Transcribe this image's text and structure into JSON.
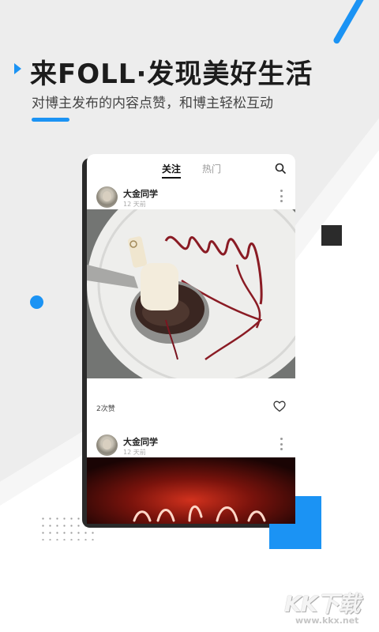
{
  "promo": {
    "headline": "来FOLL·发现美好生活",
    "subline": "对博主发布的内容点赞，和博主轻松互动"
  },
  "colors": {
    "accent": "#1b93f4",
    "dark": "#2b2b2b",
    "background_gray": "#ededed"
  },
  "feed": {
    "tabs": [
      {
        "label": "关注",
        "active": true
      },
      {
        "label": "热门",
        "active": false
      }
    ],
    "search_icon": "search-icon",
    "posts": [
      {
        "author": "大金同学",
        "time": "12 天前",
        "likes": "2次赞",
        "image": "dessert-plate-photo"
      },
      {
        "author": "大金同学",
        "time": "12 天前",
        "image": "red-neon-sign-photo"
      }
    ]
  },
  "watermark": {
    "title": "KK下载",
    "url": "www.kkx.net"
  }
}
